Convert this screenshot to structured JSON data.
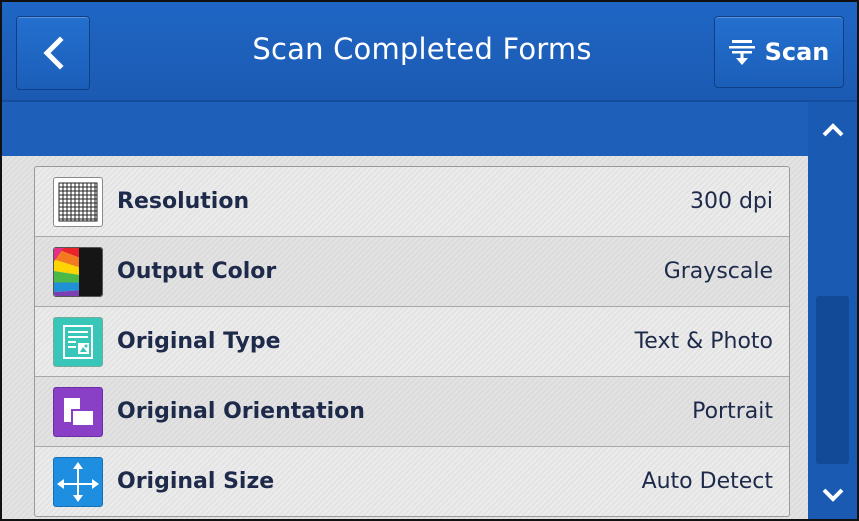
{
  "header": {
    "title": "Scan Completed Forms",
    "back_icon": "chevron-left-icon",
    "scan_label": "Scan",
    "scan_icon": "scan-document-icon"
  },
  "settings": [
    {
      "label": "Resolution",
      "value": "300 dpi",
      "icon": "resolution-grid-icon"
    },
    {
      "label": "Output Color",
      "value": "Grayscale",
      "icon": "output-color-icon"
    },
    {
      "label": "Original Type",
      "value": "Text & Photo",
      "icon": "text-photo-icon"
    },
    {
      "label": "Original Orientation",
      "value": "Portrait",
      "icon": "orientation-icon"
    },
    {
      "label": "Original Size",
      "value": "Auto Detect",
      "icon": "size-arrows-icon"
    }
  ],
  "scrollbar": {
    "up_icon": "chevron-up-icon",
    "down_icon": "chevron-down-icon",
    "position": 0.45
  },
  "colors": {
    "header_blue": "#1f66c4",
    "scroll_blue": "#1b5ab2",
    "text_dark": "#1e2a4a"
  }
}
